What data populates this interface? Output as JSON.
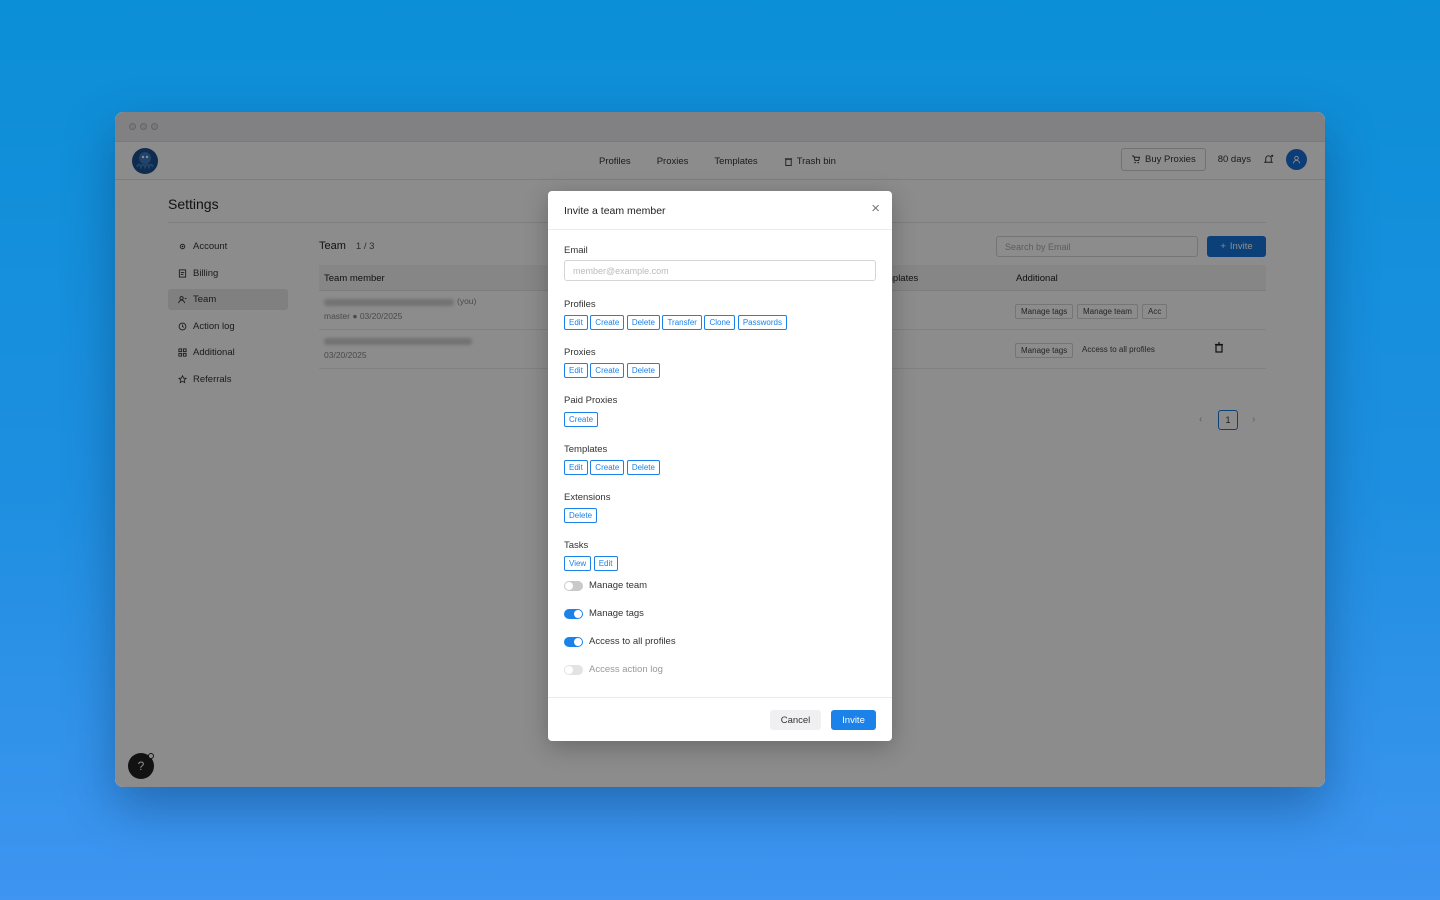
{
  "nav": {
    "profiles": "Profiles",
    "proxies": "Proxies",
    "templates": "Templates",
    "trash_bin": "Trash bin"
  },
  "topbar": {
    "buy_proxies": "Buy Proxies",
    "days": "80 days"
  },
  "settings": {
    "title": "Settings",
    "menu": [
      "Account",
      "Billing",
      "Team",
      "Action log",
      "Additional",
      "Referrals"
    ],
    "active": "Team"
  },
  "team": {
    "title": "Team",
    "count": "1 / 3",
    "search_placeholder": "Search by Email",
    "invite_label": "Invite",
    "columns": {
      "member": "Team member",
      "templates": "mplates",
      "additional": "Additional"
    },
    "rows": [
      {
        "you": "(you)",
        "sub": "master ● 03/20/2025",
        "tags": [
          "Manage tags",
          "Manage team",
          "Acc"
        ]
      },
      {
        "sub": "03/20/2025",
        "tags": [
          "Manage tags",
          "Access to all profiles"
        ]
      }
    ],
    "page": "1"
  },
  "modal": {
    "title": "Invite a team member",
    "email_label": "Email",
    "email_placeholder": "member@example.com",
    "sections": [
      {
        "label": "Profiles",
        "chips": [
          "Edit",
          "Create",
          "Delete",
          "Transfer",
          "Clone",
          "Passwords"
        ]
      },
      {
        "label": "Proxies",
        "chips": [
          "Edit",
          "Create",
          "Delete"
        ]
      },
      {
        "label": "Paid Proxies",
        "chips": [
          "Create"
        ]
      },
      {
        "label": "Templates",
        "chips": [
          "Edit",
          "Create",
          "Delete"
        ]
      },
      {
        "label": "Extensions",
        "chips": [
          "Delete"
        ]
      },
      {
        "label": "Tasks",
        "chips": [
          "View",
          "Edit"
        ]
      }
    ],
    "toggles": [
      {
        "label": "Manage team",
        "on": false
      },
      {
        "label": "Manage tags",
        "on": true
      },
      {
        "label": "Access to all profiles",
        "on": true
      },
      {
        "label": "Access action log",
        "on": false,
        "disabled": true
      }
    ],
    "cancel": "Cancel",
    "invite": "Invite"
  },
  "colors": {
    "accent": "#1a82e8",
    "background": "#0b8fd6"
  }
}
